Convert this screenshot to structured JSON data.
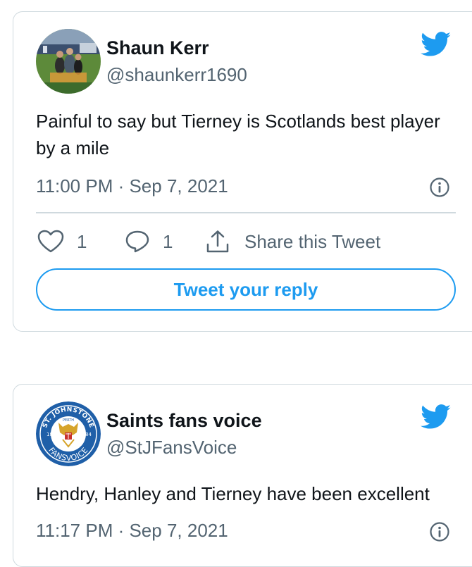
{
  "tweets": [
    {
      "author_name": "Shaun Kerr",
      "author_handle": "@shaunkerr1690",
      "text": "Painful to say but Tierney is Scotlands best player by a mile",
      "timestamp": "11:00 PM · Sep 7, 2021",
      "likes": "1",
      "replies": "1",
      "share_label": "Share this Tweet",
      "reply_button_label": "Tweet your reply",
      "avatar_icon": "photo-avatar"
    },
    {
      "author_name": "Saints fans voice",
      "author_handle": "@StJFansVoice",
      "text": "Hendry, Hanley and Tierney have been excellent",
      "timestamp": "11:17 PM · Sep 7, 2021",
      "avatar_icon": "st-johnstone-crest",
      "avatar_text": {
        "top": "ST. JOHNSTONE",
        "city": "PERTH",
        "year_left": "18",
        "year_right": "84",
        "bottom": "FANSVOICE"
      }
    }
  ],
  "colors": {
    "brand_blue": "#1d9bf0",
    "secondary_text": "#536471",
    "border": "#cfd9de",
    "crest_blue": "#1f5fa8"
  }
}
